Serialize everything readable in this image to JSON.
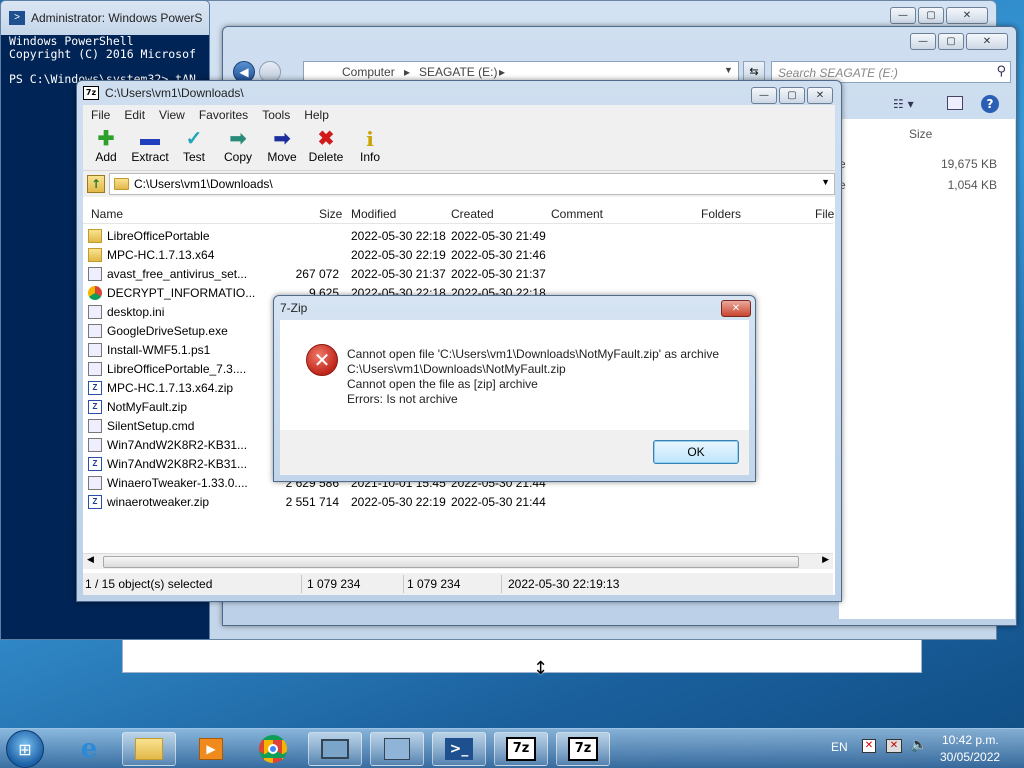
{
  "powershell": {
    "title": "Administrator: Windows PowerS",
    "lines": [
      "Windows PowerShell",
      "Copyright (C) 2016 Microsof",
      "",
      "PS C:\\Windows\\system32> tAN"
    ]
  },
  "explorer": {
    "breadcrumb": [
      "Computer",
      "SEAGATE (E:)"
    ],
    "search_placeholder": "Search SEAGATE (E:)",
    "size_header": "Size",
    "sizes": [
      "19,675 KB",
      "1,054 KB"
    ]
  },
  "zip": {
    "title": "C:\\Users\\vm1\\Downloads\\",
    "menu": [
      "File",
      "Edit",
      "View",
      "Favorites",
      "Tools",
      "Help"
    ],
    "tools": [
      {
        "label": "Add",
        "glyph": "✚",
        "color": "#2ca02c"
      },
      {
        "label": "Extract",
        "glyph": "▬",
        "color": "#1f3fbf"
      },
      {
        "label": "Test",
        "glyph": "✓",
        "color": "#21a6b8"
      },
      {
        "label": "Copy",
        "glyph": "➡",
        "color": "#2a8a7a"
      },
      {
        "label": "Move",
        "glyph": "➡",
        "color": "#1c2f9c"
      },
      {
        "label": "Delete",
        "glyph": "✖",
        "color": "#d11a1a"
      },
      {
        "label": "Info",
        "glyph": "i",
        "color": "#c8a400"
      }
    ],
    "address": "C:\\Users\\vm1\\Downloads\\",
    "columns": {
      "name": "Name",
      "size": "Size",
      "modified": "Modified",
      "created": "Created",
      "comment": "Comment",
      "folders": "Folders",
      "files": "File"
    },
    "files": [
      {
        "name": "LibreOfficePortable",
        "size": "",
        "modified": "2022-05-30 22:18",
        "created": "2022-05-30 21:49",
        "icon": "fold"
      },
      {
        "name": "MPC-HC.1.7.13.x64",
        "size": "",
        "modified": "2022-05-30 22:19",
        "created": "2022-05-30 21:46",
        "icon": "fold"
      },
      {
        "name": "avast_free_antivirus_set...",
        "size": "267 072",
        "modified": "2022-05-30 21:37",
        "created": "2022-05-30 21:37",
        "icon": "exe"
      },
      {
        "name": "DECRYPT_INFORMATIO...",
        "size": "9 625",
        "modified": "2022-05-30 22:18",
        "created": "2022-05-30 22:18",
        "icon": "chrome"
      },
      {
        "name": "desktop.ini",
        "size": "",
        "modified": "",
        "created": "",
        "icon": "ini"
      },
      {
        "name": "GoogleDriveSetup.exe",
        "size": "",
        "modified": "",
        "created": "",
        "icon": "exe"
      },
      {
        "name": "Install-WMF5.1.ps1",
        "size": "",
        "modified": "",
        "created": "",
        "icon": "exe"
      },
      {
        "name": "LibreOfficePortable_7.3....",
        "size": "",
        "modified": "",
        "created": "",
        "icon": "exe"
      },
      {
        "name": "MPC-HC.1.7.13.x64.zip",
        "size": "",
        "modified": "",
        "created": "",
        "icon": "zip"
      },
      {
        "name": "NotMyFault.zip",
        "size": "",
        "modified": "",
        "created": "",
        "icon": "zip"
      },
      {
        "name": "SilentSetup.cmd",
        "size": "",
        "modified": "",
        "created": "",
        "icon": "exe"
      },
      {
        "name": "Win7AndW2K8R2-KB31...",
        "size": "",
        "modified": "",
        "created": "",
        "icon": "exe"
      },
      {
        "name": "Win7AndW2K8R2-KB31...",
        "size": "",
        "modified": "",
        "created": "",
        "icon": "zip"
      },
      {
        "name": "WinaeroTweaker-1.33.0....",
        "size": "2 629 586",
        "modified": "2021-10-01 15:45",
        "created": "2022-05-30 21:44",
        "icon": "exe"
      },
      {
        "name": "winaerotweaker.zip",
        "size": "2 551 714",
        "modified": "2022-05-30 22:19",
        "created": "2022-05-30 21:44",
        "icon": "zip"
      }
    ],
    "status": {
      "selected": "1 / 15 object(s) selected",
      "size": "1 079 234",
      "packed": "1 079 234",
      "date": "2022-05-30 22:19:13"
    }
  },
  "dialog": {
    "title": "7-Zip",
    "lines": [
      "Cannot open file 'C:\\Users\\vm1\\Downloads\\NotMyFault.zip' as archive",
      "C:\\Users\\vm1\\Downloads\\NotMyFault.zip",
      "Cannot open the file as [zip] archive",
      "Errors: Is not archive"
    ],
    "ok": "OK"
  },
  "taskbar": {
    "lang": "EN",
    "time": "10:42 p.m.",
    "date": "30/05/2022"
  }
}
